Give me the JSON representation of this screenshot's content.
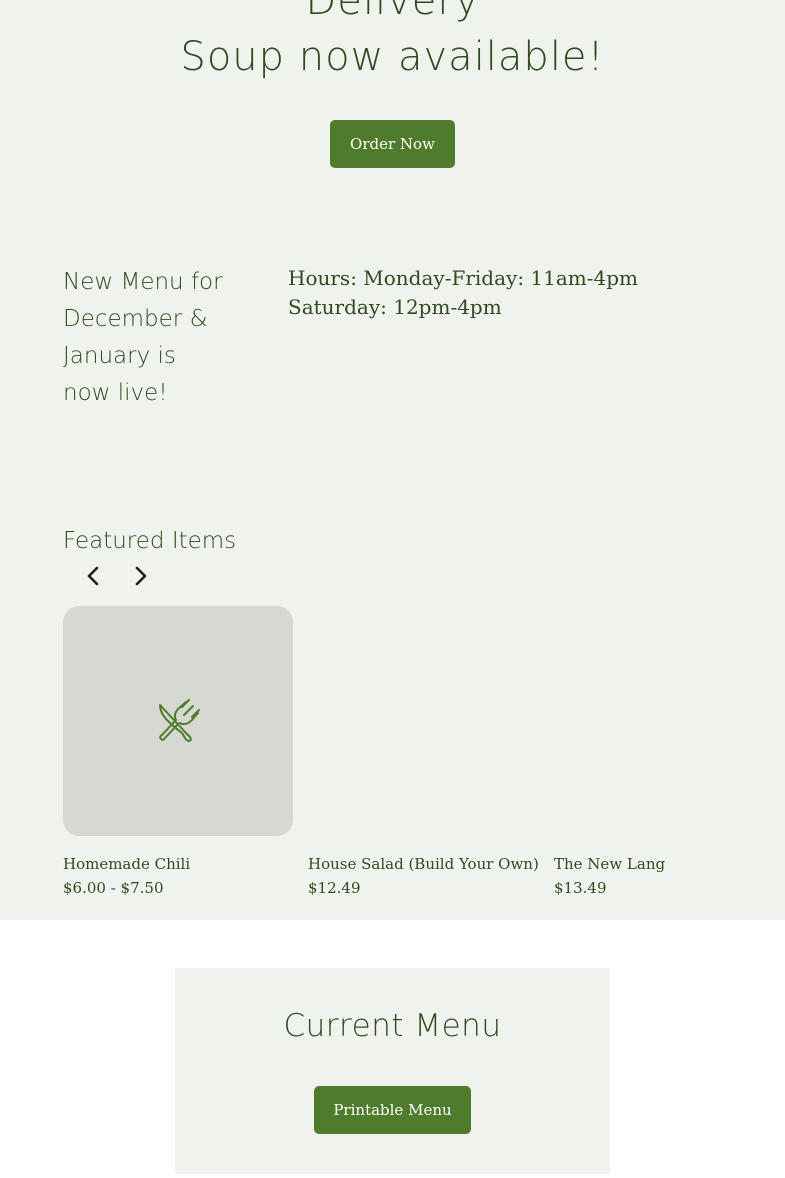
{
  "hero": {
    "line1": "Delivery",
    "line2": "Soup now available!",
    "order_button": "Order Now"
  },
  "news": {
    "title": "New Menu for December & January is now live!",
    "hours_line1": "Hours: Monday-Friday: 11am-4pm",
    "hours_line2": "Saturday: 12pm-4pm"
  },
  "featured": {
    "title": "Featured Items",
    "prev_icon": "chevron-left-icon",
    "next_icon": "chevron-right-icon",
    "placeholder_icon": "utensils-icon",
    "items": [
      {
        "name": "Homemade Chili",
        "price": "$6.00 - $7.50"
      },
      {
        "name": "House Salad (Build Your Own)",
        "price": "$12.49"
      },
      {
        "name": "The New Lang",
        "price": "$13.49"
      }
    ]
  },
  "menu_card": {
    "title": "Current Menu",
    "button": "Printable Menu"
  },
  "colors": {
    "accent": "#4e7c2c",
    "text": "#2e4a1e",
    "band_background": "#f0f2ee",
    "image_placeholder": "#d5d9d1"
  }
}
